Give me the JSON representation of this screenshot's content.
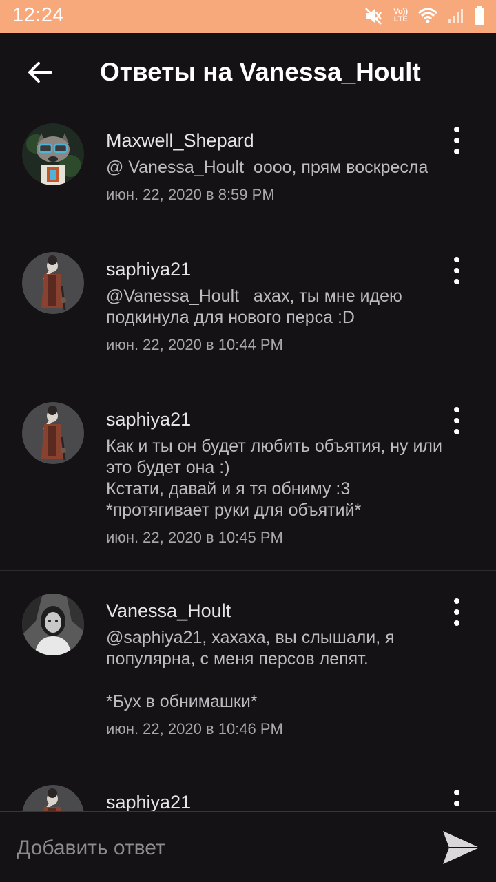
{
  "status_bar": {
    "time": "12:24",
    "icons": [
      "mute-icon",
      "volte-icon",
      "wifi-icon",
      "signal-icon",
      "battery-icon"
    ],
    "volte_label_top": "Vo))",
    "volte_label_bottom": "LTE",
    "background": "#f7a97b"
  },
  "app_bar": {
    "title": "Ответы на Vanessa_Hoult",
    "back_icon": "arrow-left-icon"
  },
  "comments": [
    {
      "author": "Maxwell_Shepard",
      "text": "@ Vanessa_Hoult  оооо, прям воскресла",
      "time": "июн. 22, 2020 в 8:59 PM",
      "avatar": "raccoon-avatar"
    },
    {
      "author": "saphiya21",
      "text": "@Vanessa_Hoult   ахах, ты мне идею подкинула для нового перса :D",
      "time": "июн. 22, 2020 в 10:44 PM",
      "avatar": "plague-doctor-avatar"
    },
    {
      "author": "saphiya21",
      "text": "Как и ты он будет любить объятия, ну или это будет она :)\nКстати, давай и я тя обниму :3\n*протягивает руки для объятий*",
      "time": "июн. 22, 2020 в 10:45 PM",
      "avatar": "plague-doctor-avatar"
    },
    {
      "author": "Vanessa_Hoult",
      "text": "@saphiya21, хахаха, вы слышали, я популярна, с меня персов лепят.\n\n*Бух в обнимашки*",
      "time": "июн. 22, 2020 в 10:46 PM",
      "avatar": "woman-portrait-avatar"
    },
    {
      "author": "saphiya21",
      "text": "",
      "time": "",
      "avatar": "plague-doctor-avatar"
    }
  ],
  "composer": {
    "placeholder": "Добавить ответ",
    "send_icon": "send-icon"
  }
}
